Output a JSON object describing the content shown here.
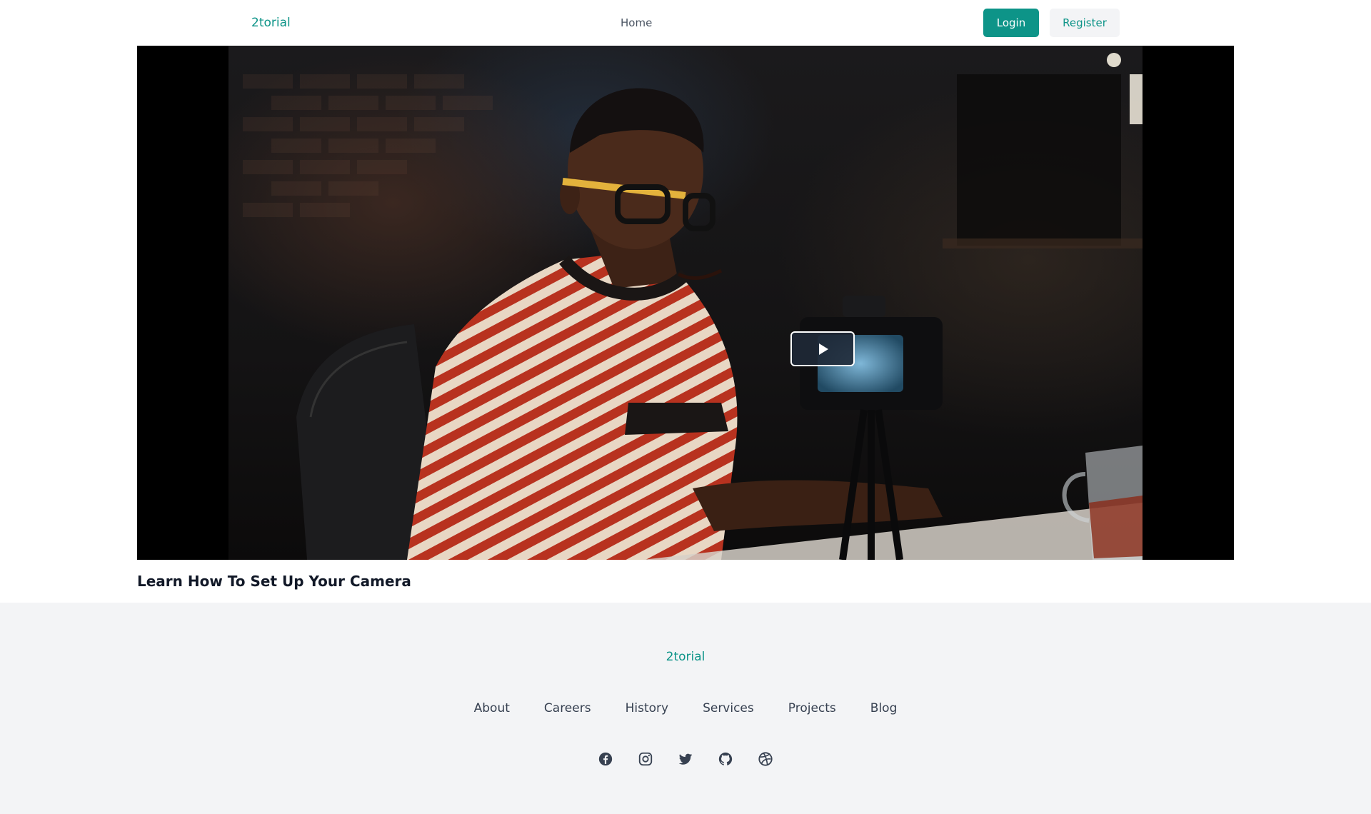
{
  "header": {
    "logo": "2torial",
    "nav_home": "Home",
    "login_label": "Login",
    "register_label": "Register"
  },
  "video": {
    "title": "Learn How To Set Up Your Camera",
    "play_icon": "play-icon"
  },
  "footer": {
    "logo": "2torial",
    "links": [
      "About",
      "Careers",
      "History",
      "Services",
      "Projects",
      "Blog"
    ],
    "social_icons": [
      "facebook-icon",
      "instagram-icon",
      "twitter-icon",
      "github-icon",
      "dribbble-icon"
    ]
  },
  "colors": {
    "accent": "#0d9488",
    "footer_bg": "#f3f4f6",
    "text_dark": "#111827",
    "text_muted": "#4b5563"
  }
}
